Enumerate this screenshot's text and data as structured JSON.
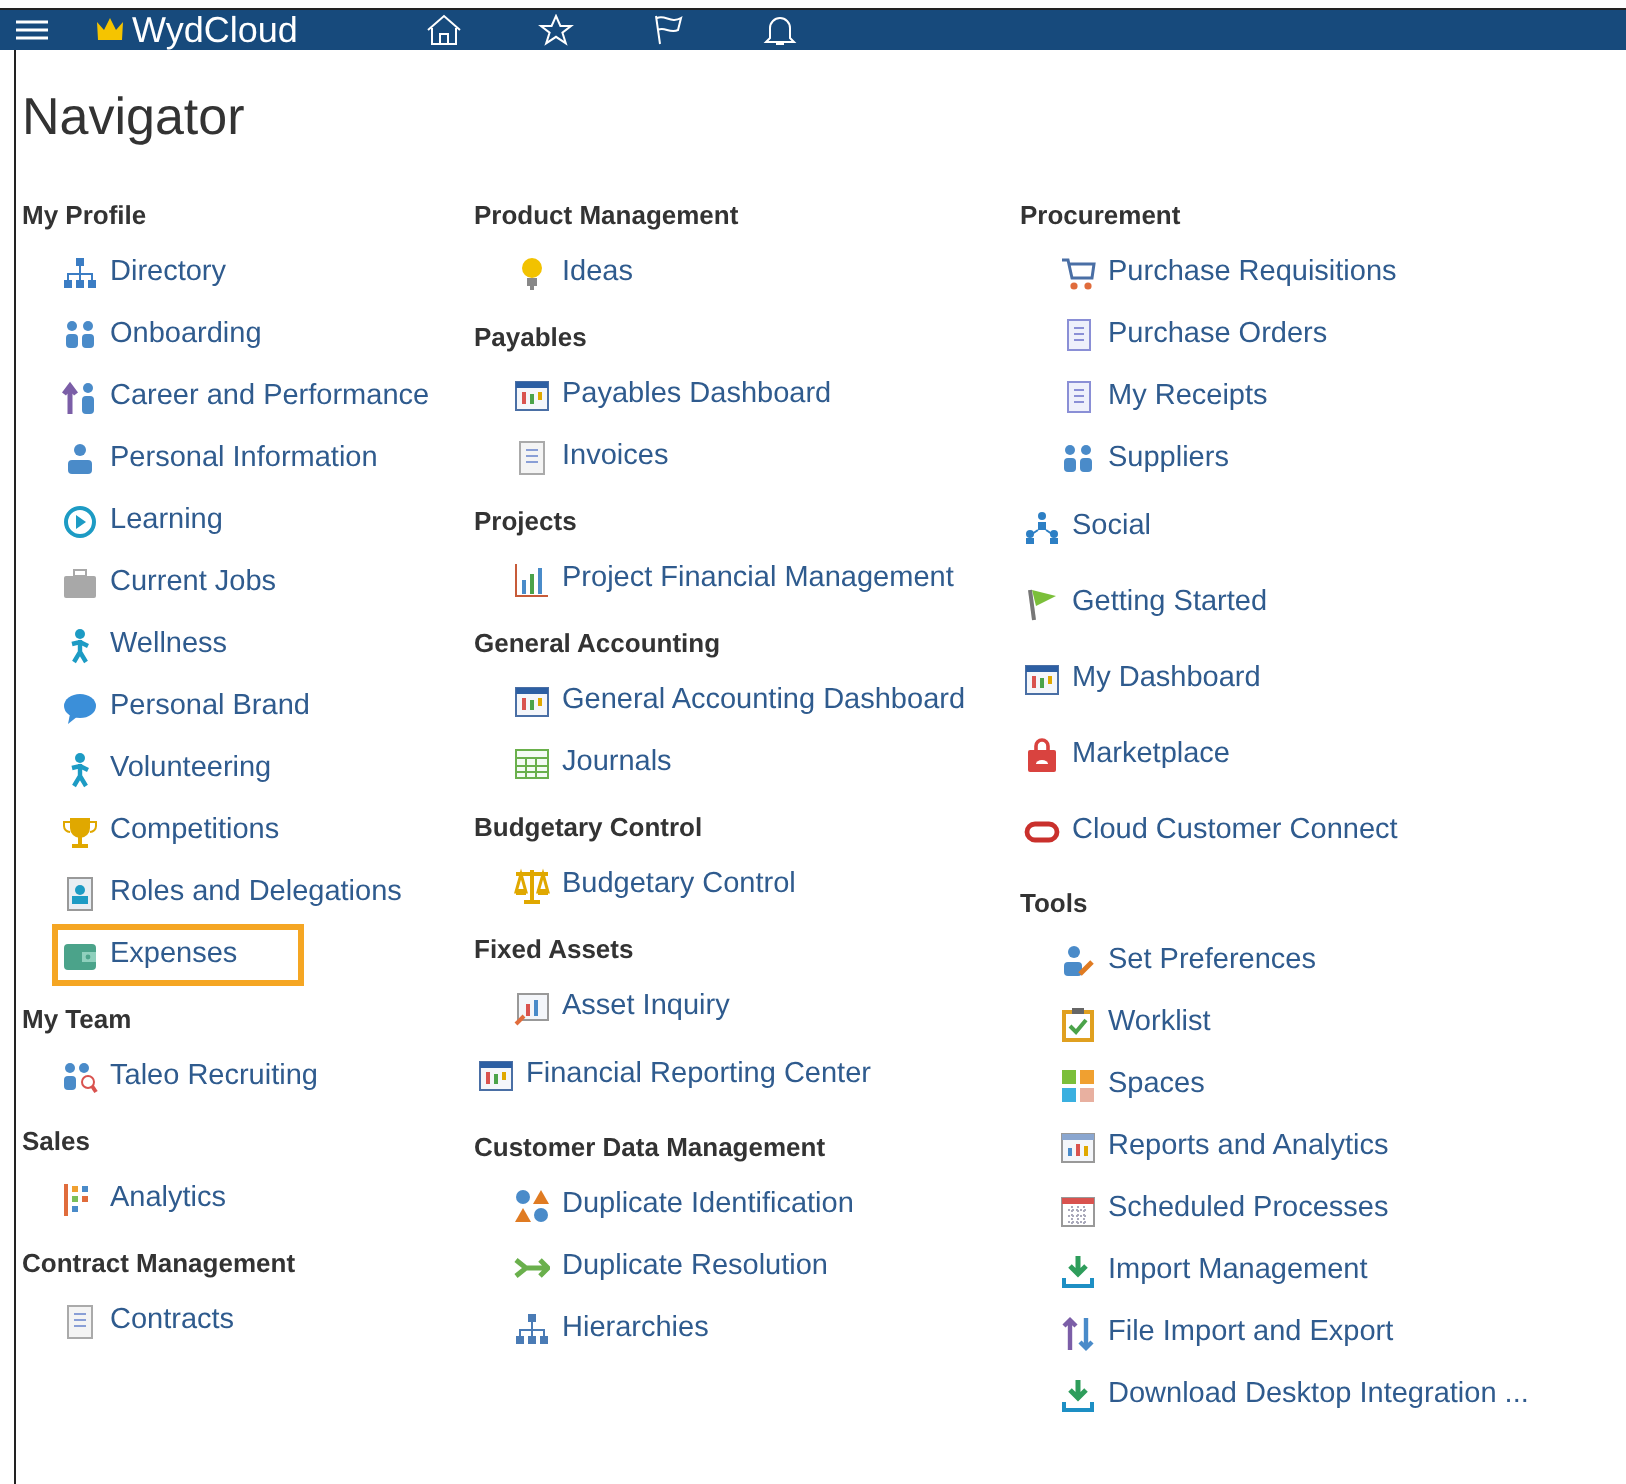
{
  "top_bar": {
    "logo": "WydCloud"
  },
  "title": "Navigator",
  "columns": [
    {
      "entries": [
        {
          "kind": "group",
          "heading": "My Profile",
          "items": [
            {
              "label": "Directory",
              "selected": false
            },
            {
              "label": "Onboarding",
              "selected": false
            },
            {
              "label": "Career and Performance",
              "selected": false
            },
            {
              "label": "Personal Information",
              "selected": false
            },
            {
              "label": "Learning",
              "selected": false
            },
            {
              "label": "Current Jobs",
              "selected": false
            },
            {
              "label": "Wellness",
              "selected": false
            },
            {
              "label": "Personal Brand",
              "selected": false
            },
            {
              "label": "Volunteering",
              "selected": false
            },
            {
              "label": "Competitions",
              "selected": false
            },
            {
              "label": "Roles and Delegations",
              "selected": false
            },
            {
              "label": "Expenses",
              "selected": true
            }
          ]
        },
        {
          "kind": "group",
          "heading": "My Team",
          "items": [
            {
              "label": "Taleo Recruiting",
              "selected": false
            }
          ]
        },
        {
          "kind": "group",
          "heading": "Sales",
          "items": [
            {
              "label": "Analytics",
              "selected": false
            }
          ]
        },
        {
          "kind": "group",
          "heading": "Contract Management",
          "items": [
            {
              "label": "Contracts",
              "selected": false
            }
          ]
        }
      ]
    },
    {
      "entries": [
        {
          "kind": "group",
          "heading": "Product Management",
          "items": [
            {
              "label": "Ideas",
              "selected": false
            }
          ]
        },
        {
          "kind": "group",
          "heading": "Payables",
          "items": [
            {
              "label": "Payables Dashboard",
              "selected": false
            },
            {
              "label": "Invoices",
              "selected": false
            }
          ]
        },
        {
          "kind": "group",
          "heading": "Projects",
          "items": [
            {
              "label": "Project Financial Management",
              "selected": false
            }
          ]
        },
        {
          "kind": "group",
          "heading": "General Accounting",
          "items": [
            {
              "label": "General Accounting Dashboard",
              "selected": false
            },
            {
              "label": "Journals",
              "selected": false
            }
          ]
        },
        {
          "kind": "group",
          "heading": "Budgetary Control",
          "items": [
            {
              "label": "Budgetary Control",
              "selected": false
            }
          ]
        },
        {
          "kind": "group",
          "heading": "Fixed Assets",
          "items": [
            {
              "label": "Asset Inquiry",
              "selected": false
            }
          ]
        },
        {
          "kind": "link",
          "label": "Financial Reporting Center",
          "selected": false
        },
        {
          "kind": "group",
          "heading": "Customer Data Management",
          "items": [
            {
              "label": "Duplicate Identification",
              "selected": false
            },
            {
              "label": "Duplicate Resolution",
              "selected": false
            },
            {
              "label": "Hierarchies",
              "selected": false
            }
          ]
        }
      ]
    },
    {
      "entries": [
        {
          "kind": "group",
          "heading": "Procurement",
          "items": [
            {
              "label": "Purchase Requisitions",
              "selected": false
            },
            {
              "label": "Purchase Orders",
              "selected": false
            },
            {
              "label": "My Receipts",
              "selected": false
            },
            {
              "label": "Suppliers",
              "selected": false
            }
          ]
        },
        {
          "kind": "link",
          "label": "Social",
          "selected": false
        },
        {
          "kind": "link",
          "label": "Getting Started",
          "selected": false
        },
        {
          "kind": "link",
          "label": "My Dashboard",
          "selected": false
        },
        {
          "kind": "link",
          "label": "Marketplace",
          "selected": false
        },
        {
          "kind": "link",
          "label": "Cloud Customer Connect",
          "selected": false
        },
        {
          "kind": "group",
          "heading": "Tools",
          "items": [
            {
              "label": "Set Preferences",
              "selected": false
            },
            {
              "label": "Worklist",
              "selected": false
            },
            {
              "label": "Spaces",
              "selected": false
            },
            {
              "label": "Reports and Analytics",
              "selected": false
            },
            {
              "label": "Scheduled Processes",
              "selected": false
            },
            {
              "label": "Import Management",
              "selected": false
            },
            {
              "label": "File Import and Export",
              "selected": false
            },
            {
              "label": "Download Desktop Integration ...",
              "selected": false
            }
          ]
        }
      ]
    }
  ]
}
